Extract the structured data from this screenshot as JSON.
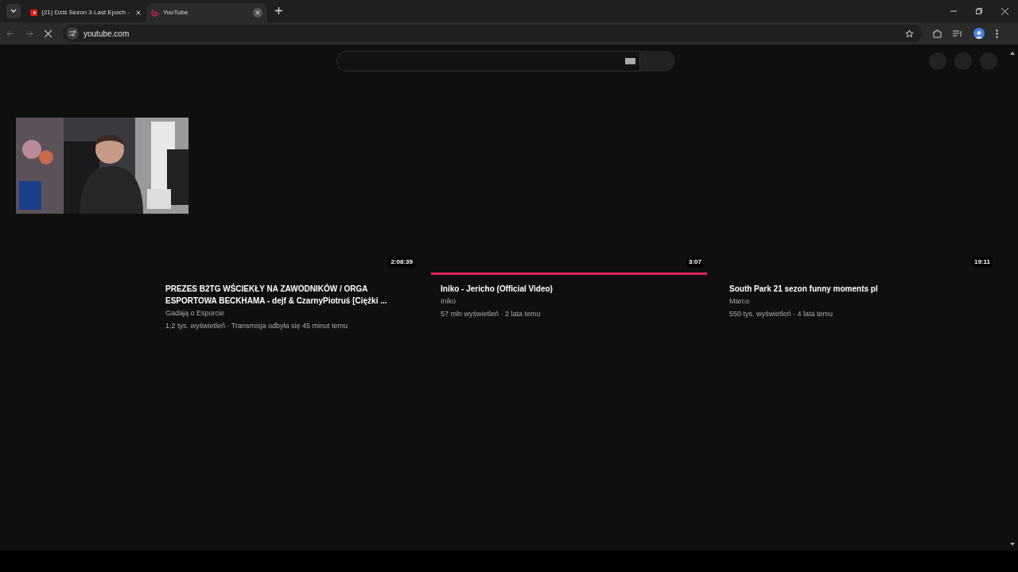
{
  "browser_tabs": [
    {
      "title": "(21) Dziś Sezon 3 Last Epoch -",
      "selected": false
    },
    {
      "title": "YouTube",
      "selected": true
    }
  ],
  "address_bar": {
    "url": "youtube.com"
  },
  "videos": [
    {
      "duration": "2:08:39",
      "title": "PREZES B2TG WŚCIEKŁY NA ZAWODNIKÓW / ORGA ESPORTOWA BECKHAMA - dejf & CzarnyPiotruś [Ciężki ...",
      "channel": "Gadają o Esporcie",
      "meta": "1,2 tys. wyświetleń · Transmisja odbyła się 45 minut temu"
    },
    {
      "duration": "3:07",
      "title": "Iniko - Jericho (Official Video)",
      "channel": "Iniko",
      "meta": "57 mln wyświetleń · 2 lata temu",
      "watched": {
        "level": 1
      }
    },
    {
      "duration": "19:11",
      "title": "South Park 21 sezon funny moments pl",
      "channel": "Marco",
      "meta": "550 tys. wyświetleń · 4 lata temu"
    }
  ]
}
